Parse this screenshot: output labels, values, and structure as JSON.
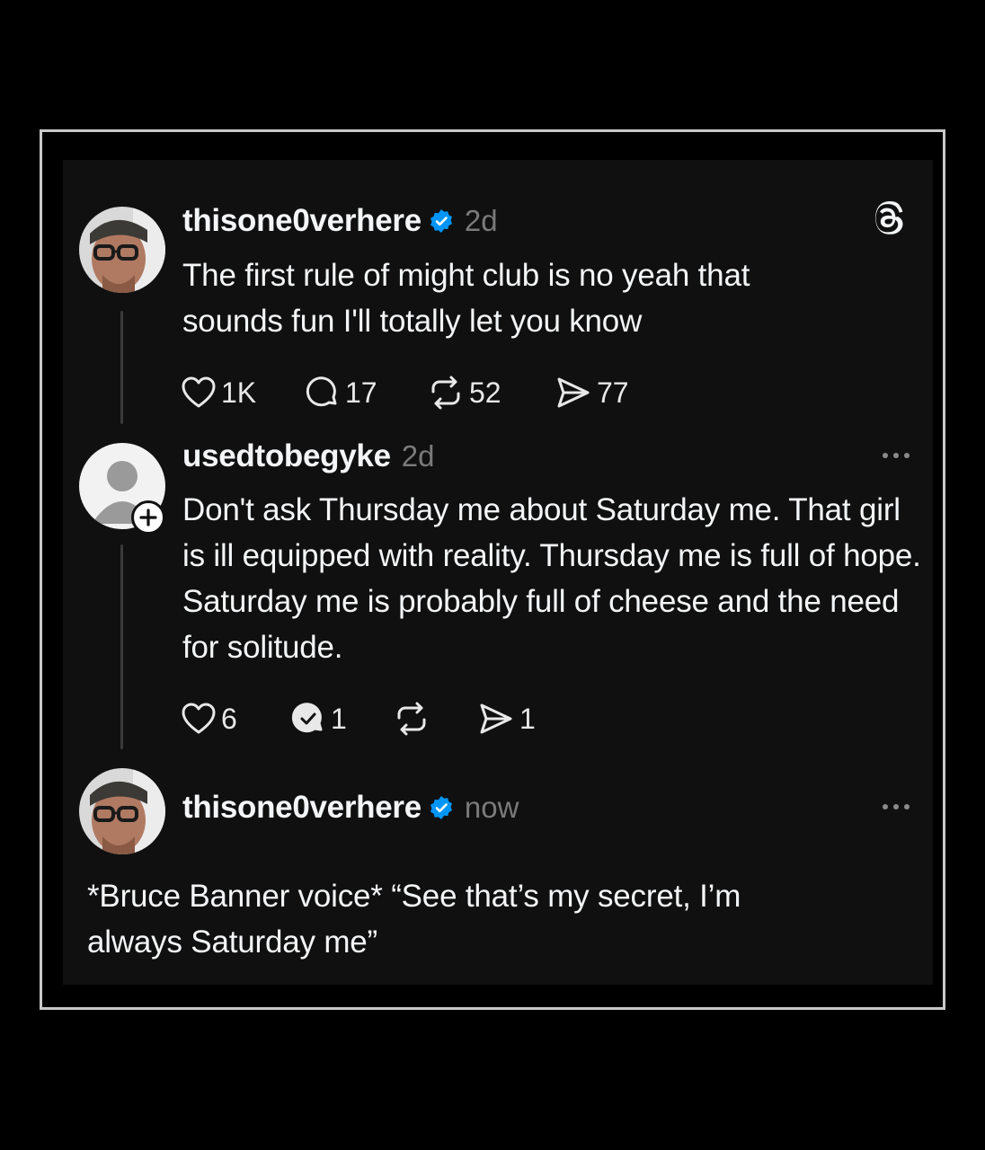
{
  "posts": [
    {
      "username": "thisone0verhere",
      "verified": true,
      "time": "2d",
      "text": "The first rule of might club is no yeah that sounds fun I'll totally let you know",
      "likes": "1K",
      "replies": "17",
      "reposts": "52",
      "shares": "77",
      "icon": "avatar-photo"
    },
    {
      "username": "usedtobegyke",
      "verified": false,
      "time": "2d",
      "text": "Don't ask Thursday me about Saturday me. That girl is ill equipped with reality. Thursday me is full of hope. Saturday me is probably full of cheese and the need for solitude.",
      "likes": "6",
      "replies": "1",
      "reposts": "",
      "shares": "1",
      "icon": "default-avatar"
    },
    {
      "username": "thisone0verhere",
      "verified": true,
      "time": "now",
      "text": "*Bruce Banner voice* “See that’s my secret, I’m always Saturday me”",
      "icon": "avatar-photo"
    }
  ],
  "colors": {
    "background": "#000000",
    "card": "#101010",
    "text": "#f3f5f7",
    "muted": "#7a7a7a",
    "verified": "#0095f6",
    "frame_border": "#c9c9c9"
  }
}
